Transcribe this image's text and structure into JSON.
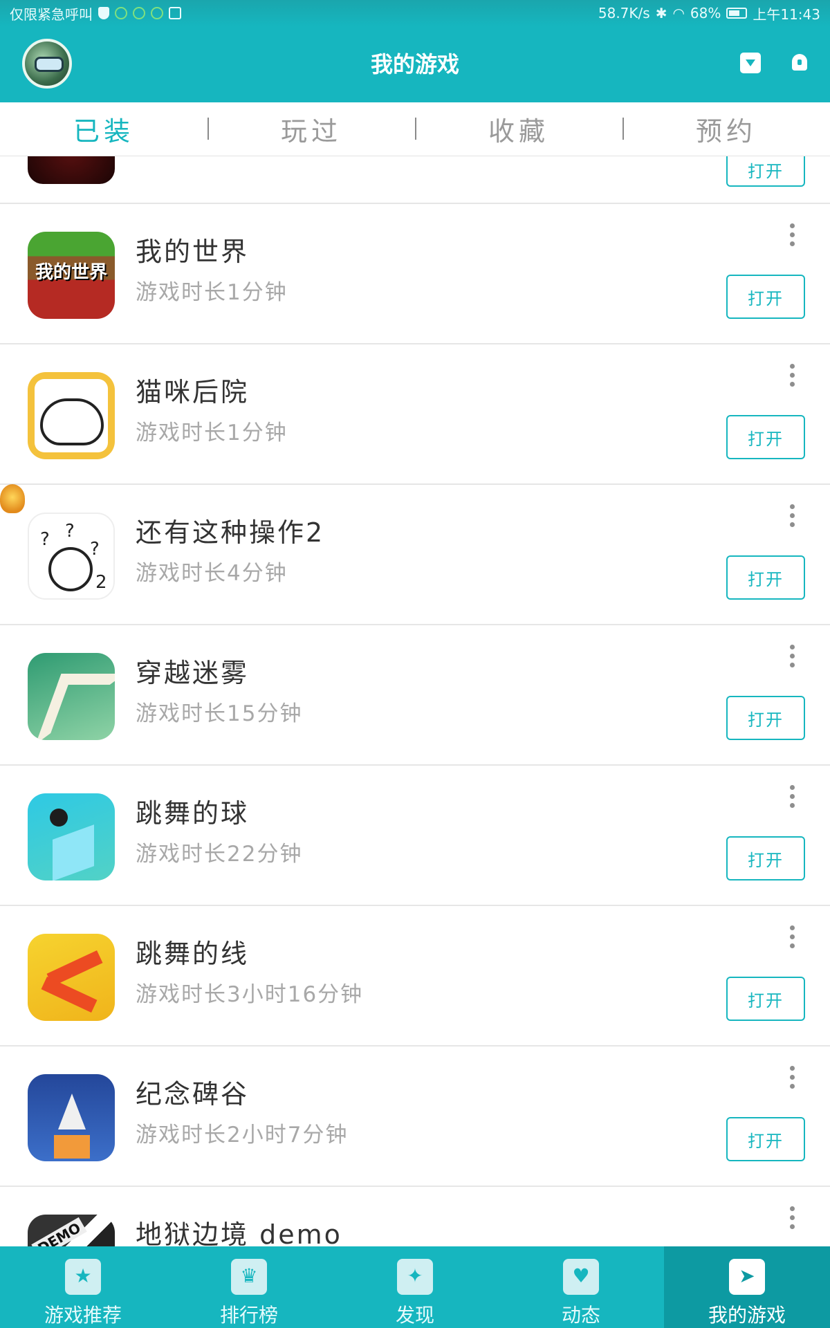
{
  "status_bar": {
    "left_text": "仅限紧急呼叫",
    "speed": "58.7K/s",
    "battery": "68%",
    "battery_level": 0.68,
    "time": "上午11:43"
  },
  "header": {
    "title": "我的游戏"
  },
  "tabs": [
    {
      "label": "已装",
      "active": true
    },
    {
      "label": "玩过",
      "active": false
    },
    {
      "label": "收藏",
      "active": false
    },
    {
      "label": "预约",
      "active": false
    }
  ],
  "list": {
    "open_label": "打开",
    "partial_top_button": "打开",
    "items": [
      {
        "name": "我的世界",
        "time": "游戏时长1分钟",
        "icon": "minecraft-icon",
        "icon_text": "我的世界"
      },
      {
        "name": "猫咪后院",
        "time": "游戏时长1分钟",
        "icon": "neko-atsume-icon"
      },
      {
        "name": "还有这种操作2",
        "time": "游戏时长4分钟",
        "icon": "question-face-icon"
      },
      {
        "name": "穿越迷雾",
        "time": "游戏时长15分钟",
        "icon": "fog-path-icon"
      },
      {
        "name": "跳舞的球",
        "time": "游戏时长22分钟",
        "icon": "dancing-ball-icon"
      },
      {
        "name": "跳舞的线",
        "time": "游戏时长3小时16分钟",
        "icon": "dancing-line-icon"
      },
      {
        "name": "纪念碑谷",
        "time": "游戏时长2小时7分钟",
        "icon": "monument-valley-icon"
      },
      {
        "name": "地狱边境  demo",
        "time": "",
        "icon": "limbo-demo-icon",
        "icon_text": "DEMO"
      }
    ]
  },
  "bottom_nav": [
    {
      "label": "游戏推荐",
      "icon": "star-icon",
      "active": false
    },
    {
      "label": "排行榜",
      "icon": "trophy-icon",
      "active": false
    },
    {
      "label": "发现",
      "icon": "sparkle-icon",
      "active": false
    },
    {
      "label": "动态",
      "icon": "heart-icon",
      "active": false
    },
    {
      "label": "我的游戏",
      "icon": "send-icon",
      "active": true
    }
  ],
  "colors": {
    "accent": "#16b6bf",
    "nav_active": "#0d9aa2",
    "text_primary": "#333333",
    "text_secondary": "#a8a8a8"
  }
}
